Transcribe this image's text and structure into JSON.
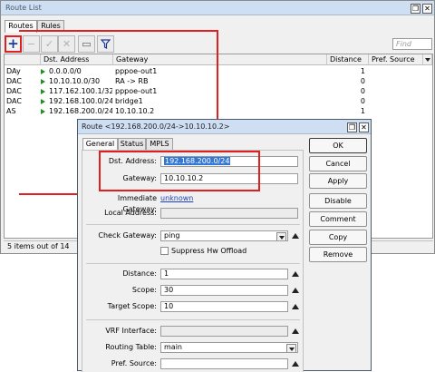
{
  "route_list": {
    "title": "Route List",
    "tabs": [
      "Routes",
      "Rules"
    ],
    "toolbar": {
      "add": "+",
      "remove": "−",
      "enable": "✓",
      "disable": "✕",
      "comment": "▭",
      "filter": "Y",
      "find_placeholder": "Find"
    },
    "columns": [
      "",
      "Dst. Address",
      "Gateway",
      "Distance",
      "Pref. Source"
    ],
    "rows": [
      {
        "flags": "DAy",
        "dst": "0.0.0.0/0",
        "gateway": "pppoe-out1",
        "distance": "1"
      },
      {
        "flags": "DAC",
        "dst": "10.10.10.0/30",
        "gateway": "RA -> RB",
        "distance": "0"
      },
      {
        "flags": "DAC",
        "dst": "117.162.100.1/32",
        "gateway": "pppoe-out1",
        "distance": "0"
      },
      {
        "flags": "DAC",
        "dst": "192.168.100.0/24",
        "gateway": "bridge1",
        "distance": "0"
      },
      {
        "flags": "AS",
        "dst": "192.168.200.0/24",
        "gateway": "10.10.10.2",
        "distance": "1"
      }
    ],
    "status": "5 items out of 14"
  },
  "dialog": {
    "title": "Route <192.168.200.0/24->10.10.10.2>",
    "tabs": [
      "General",
      "Status",
      "MPLS"
    ],
    "fields": {
      "dst_label": "Dst. Address:",
      "dst_value": "192.168.200.0/24",
      "gateway_label": "Gateway:",
      "gateway_value": "10.10.10.2",
      "imm_gw_label": "Immediate Gateway:",
      "imm_gw_value": "unknown",
      "local_label": "Local Address:",
      "check_gw_label": "Check Gateway:",
      "check_gw_value": "ping",
      "suppress_label": "Suppress Hw Offload",
      "distance_label": "Distance:",
      "distance_value": "1",
      "scope_label": "Scope:",
      "scope_value": "30",
      "target_scope_label": "Target Scope:",
      "target_scope_value": "10",
      "vrf_label": "VRF Interface:",
      "routing_table_label": "Routing Table:",
      "routing_table_value": "main",
      "pref_source_label": "Pref. Source:"
    },
    "buttons": [
      "OK",
      "Cancel",
      "Apply",
      "Disable",
      "Comment",
      "Copy",
      "Remove"
    ]
  },
  "colors": {
    "highlight": "#e02020",
    "title_bar": "#cfdff3",
    "selection": "#3378d6"
  }
}
